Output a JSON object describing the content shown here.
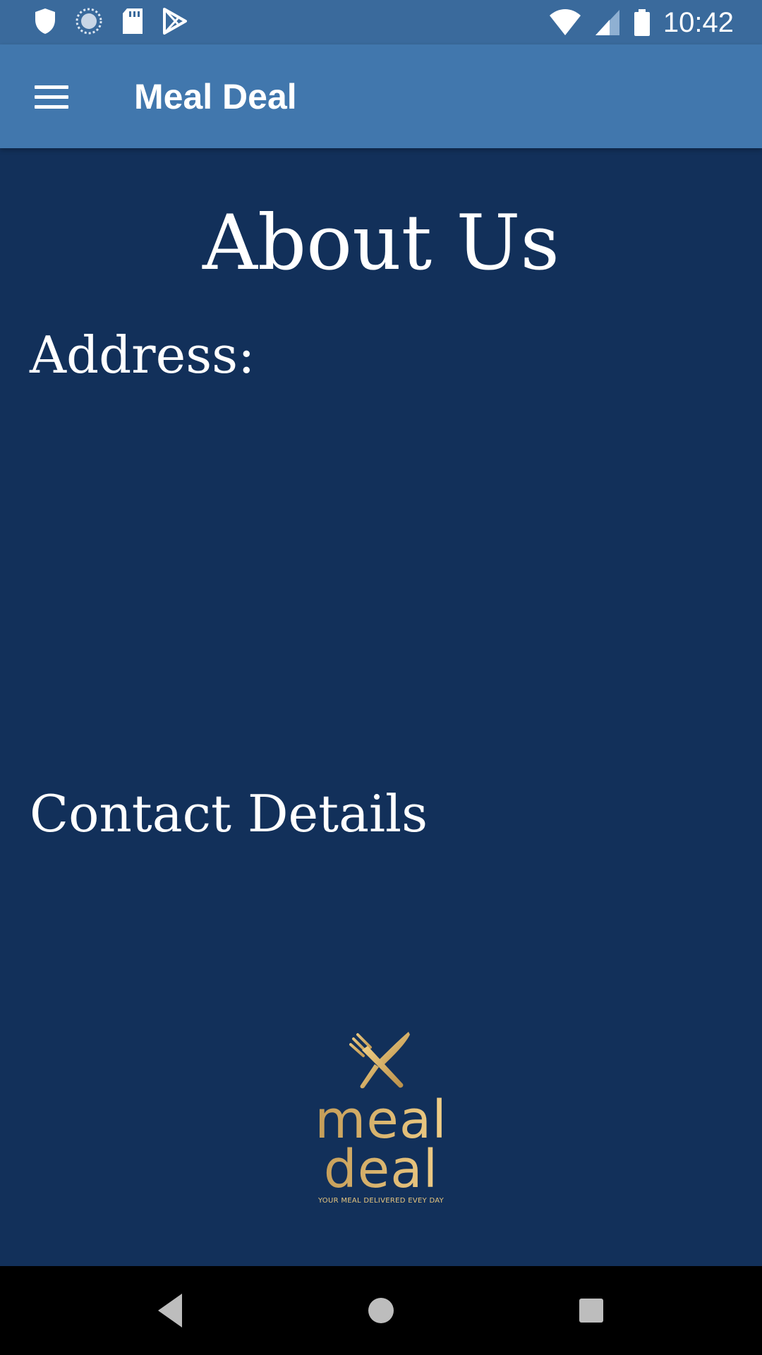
{
  "status_bar": {
    "time": "10:42",
    "icons": [
      "shield-icon",
      "sync-icon",
      "sd-card-icon",
      "play-store-icon",
      "wifi-icon",
      "signal-icon",
      "battery-icon"
    ]
  },
  "app_bar": {
    "title": "Meal Deal",
    "menu_icon": "hamburger-menu-icon"
  },
  "page": {
    "title": "About Us",
    "address_heading": "Address:",
    "contact_heading": "Contact Details"
  },
  "logo": {
    "word1": "meal",
    "word2": "deal",
    "tagline": "YOUR MEAL DELIVERED EVEY DAY"
  },
  "nav_bar": {
    "back": "back-icon",
    "home": "home-icon",
    "recents": "recents-icon"
  },
  "colors": {
    "status_bar": "#3a6a9c",
    "app_bar": "#4177ad",
    "background": "#12305a",
    "logo_gold": "#d9b36c"
  }
}
